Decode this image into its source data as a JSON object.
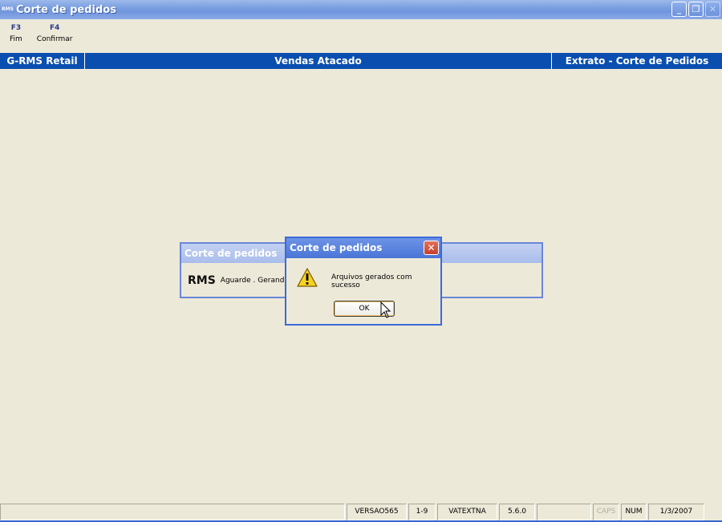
{
  "window": {
    "title": "Corte de pedidos",
    "app_icon": "RMS",
    "controls": [
      "minimize-icon",
      "restore-icon",
      "close-icon"
    ]
  },
  "function_keys": [
    {
      "key": "F3",
      "label": "Fim"
    },
    {
      "key": "F4",
      "label": "Confirmar"
    }
  ],
  "header_band": {
    "left": "G-RMS Retail",
    "center": "Vendas Atacado",
    "right": "Extrato - Corte de Pedidos"
  },
  "background_dialog": {
    "title": "Corte de pedidos",
    "logo_text": "RMS",
    "message": "Aguarde . Gerand"
  },
  "message_box": {
    "title": "Corte de pedidos",
    "icon": "warning-icon",
    "message": "Arquivos gerados com sucesso",
    "ok_label": "OK"
  },
  "status_bar": {
    "version": "VERSAO565",
    "range": "1-9",
    "program": "VATEXTNA",
    "release": "5.6.0",
    "caps": "CAPS",
    "num": "NUM",
    "date": "1/3/2007"
  },
  "colors": {
    "titlebar": "#7A9FE0",
    "band": "#0A4FB0",
    "desktop": "#ECE9D8"
  }
}
